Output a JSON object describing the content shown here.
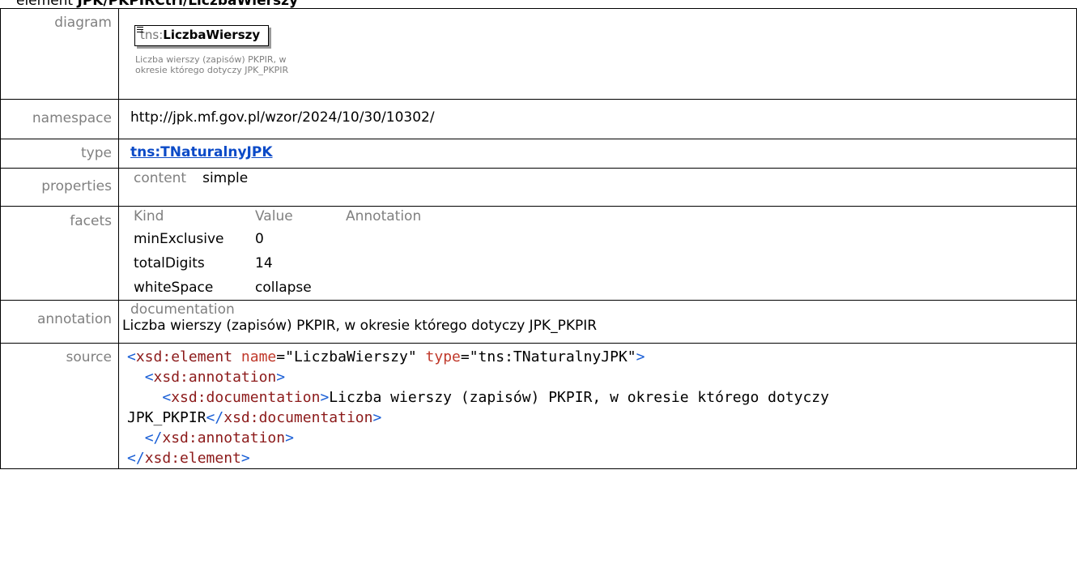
{
  "header": {
    "prefix": "element ",
    "path": "JPK/PKPIRCtrl/LiczbaWierszy"
  },
  "labels": {
    "diagram": "diagram",
    "namespace": "namespace",
    "type": "type",
    "properties": "properties",
    "facets": "facets",
    "annotation": "annotation",
    "source": "source"
  },
  "diagram": {
    "prefix": "tns:",
    "name": "LiczbaWierszy",
    "doc": "Liczba wierszy (zapisów) PKPIR, w okresie którego dotyczy JPK_PKPIR"
  },
  "namespace": "http://jpk.mf.gov.pl/wzor/2024/10/30/10302/",
  "type": {
    "label": "tns:TNaturalnyJPK"
  },
  "properties": {
    "key": "content",
    "value": "simple"
  },
  "facets": {
    "headers": [
      "Kind",
      "Value",
      "Annotation"
    ],
    "rows": [
      {
        "kind": "minExclusive",
        "value": "0"
      },
      {
        "kind": "totalDigits",
        "value": "14"
      },
      {
        "kind": "whiteSpace",
        "value": "collapse"
      }
    ]
  },
  "annotation": {
    "key": "documentation",
    "text": "Liczba wierszy (zapisów) PKPIR, w okresie którego dotyczy JPK_PKPIR"
  },
  "source": {
    "el_open": "xsd:element",
    "attr_name": "name",
    "name_value": "\"LiczbaWierszy\"",
    "attr_type": "type",
    "type_value": "\"tns:TNaturalnyJPK\"",
    "annotation_tag": "xsd:annotation",
    "doc_tag": "xsd:documentation",
    "doc_text_1": "Liczba wierszy (zapisów) PKPIR, w okresie którego dotyczy",
    "doc_text_2": "JPK_PKPIR",
    "el_close": "xsd:element"
  },
  "colors": {
    "link": "#0b4ac7",
    "label_gray": "#808080",
    "xml_tag": "#8c1a1a",
    "xml_bracket": "#1a5fd6",
    "xml_attr": "#c0392b"
  }
}
